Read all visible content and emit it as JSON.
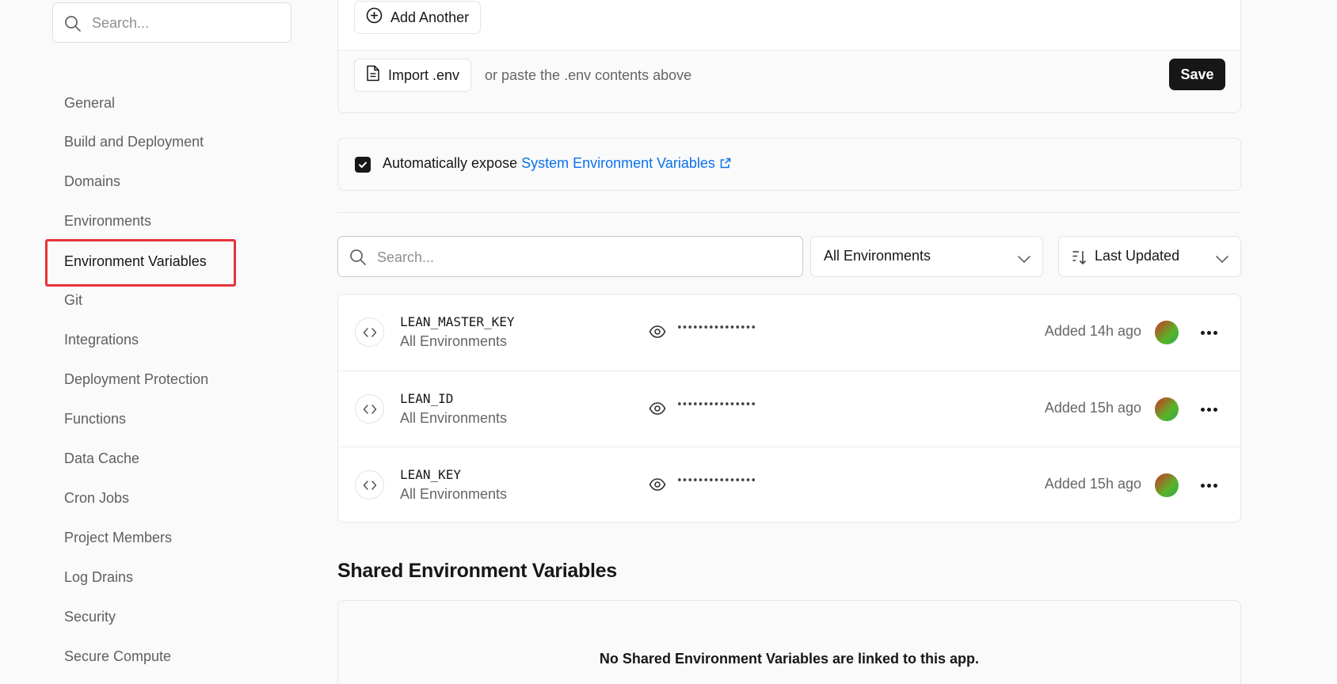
{
  "sidebar": {
    "search_placeholder": "Search...",
    "items": [
      {
        "label": "General"
      },
      {
        "label": "Build and Deployment"
      },
      {
        "label": "Domains"
      },
      {
        "label": "Environments"
      },
      {
        "label": "Environment Variables",
        "active": true
      },
      {
        "label": "Git"
      },
      {
        "label": "Integrations"
      },
      {
        "label": "Deployment Protection"
      },
      {
        "label": "Functions"
      },
      {
        "label": "Data Cache"
      },
      {
        "label": "Cron Jobs"
      },
      {
        "label": "Project Members"
      },
      {
        "label": "Log Drains"
      },
      {
        "label": "Security"
      },
      {
        "label": "Secure Compute"
      }
    ]
  },
  "form": {
    "add_another_label": "Add Another",
    "import_label": "Import .env",
    "paste_hint": "or paste the .env contents above",
    "save_label": "Save"
  },
  "expose": {
    "checked": true,
    "prefix": "Automatically expose",
    "link_text": "System Environment Variables"
  },
  "filters": {
    "search_placeholder": "Search...",
    "environment_select": "All Environments",
    "sort_select": "Last Updated"
  },
  "variables": [
    {
      "key": "LEAN_MASTER_KEY",
      "environment": "All Environments",
      "masked_value": "•••••••••••••••",
      "added": "Added 14h ago"
    },
    {
      "key": "LEAN_ID",
      "environment": "All Environments",
      "masked_value": "•••••••••••••••",
      "added": "Added 15h ago"
    },
    {
      "key": "LEAN_KEY",
      "environment": "All Environments",
      "masked_value": "•••••••••••••••",
      "added": "Added 15h ago"
    }
  ],
  "shared": {
    "heading": "Shared Environment Variables",
    "empty_message": "No Shared Environment Variables are linked to this app."
  },
  "colors": {
    "accent_link": "#0a72ef",
    "primary_button": "#171717",
    "highlight": "#e8333b"
  }
}
